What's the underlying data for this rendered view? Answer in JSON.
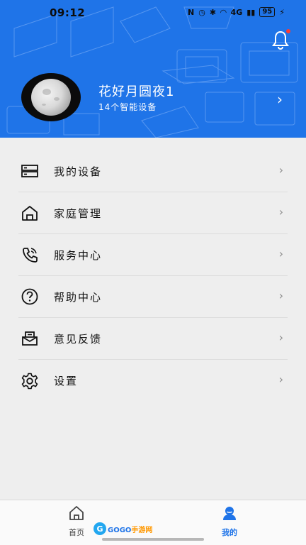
{
  "status_bar": {
    "time": "09:12",
    "signal_text": "4G",
    "battery": "95"
  },
  "header": {
    "user_name": "花好月圆夜1",
    "device_count": "14个智能设备",
    "bell_icon": "bell-icon",
    "notification_dot_color": "#ff3b30",
    "background_color": "#1f74e8"
  },
  "menu": {
    "items": [
      {
        "label": "我的设备",
        "icon": "server-icon"
      },
      {
        "label": "家庭管理",
        "icon": "house-icon"
      },
      {
        "label": "服务中心",
        "icon": "phone-icon"
      },
      {
        "label": "帮助中心",
        "icon": "help-icon"
      },
      {
        "label": "意见反馈",
        "icon": "mail-icon"
      },
      {
        "label": "设置",
        "icon": "gear-icon"
      }
    ]
  },
  "tabbar": {
    "tabs": [
      {
        "label": "首页",
        "icon": "home-icon",
        "active": false
      },
      {
        "label": "我的",
        "icon": "user-icon",
        "active": true
      }
    ]
  },
  "watermark": {
    "logo_letter": "G",
    "text_blue": "GOGO",
    "text_orange": "手游网"
  }
}
